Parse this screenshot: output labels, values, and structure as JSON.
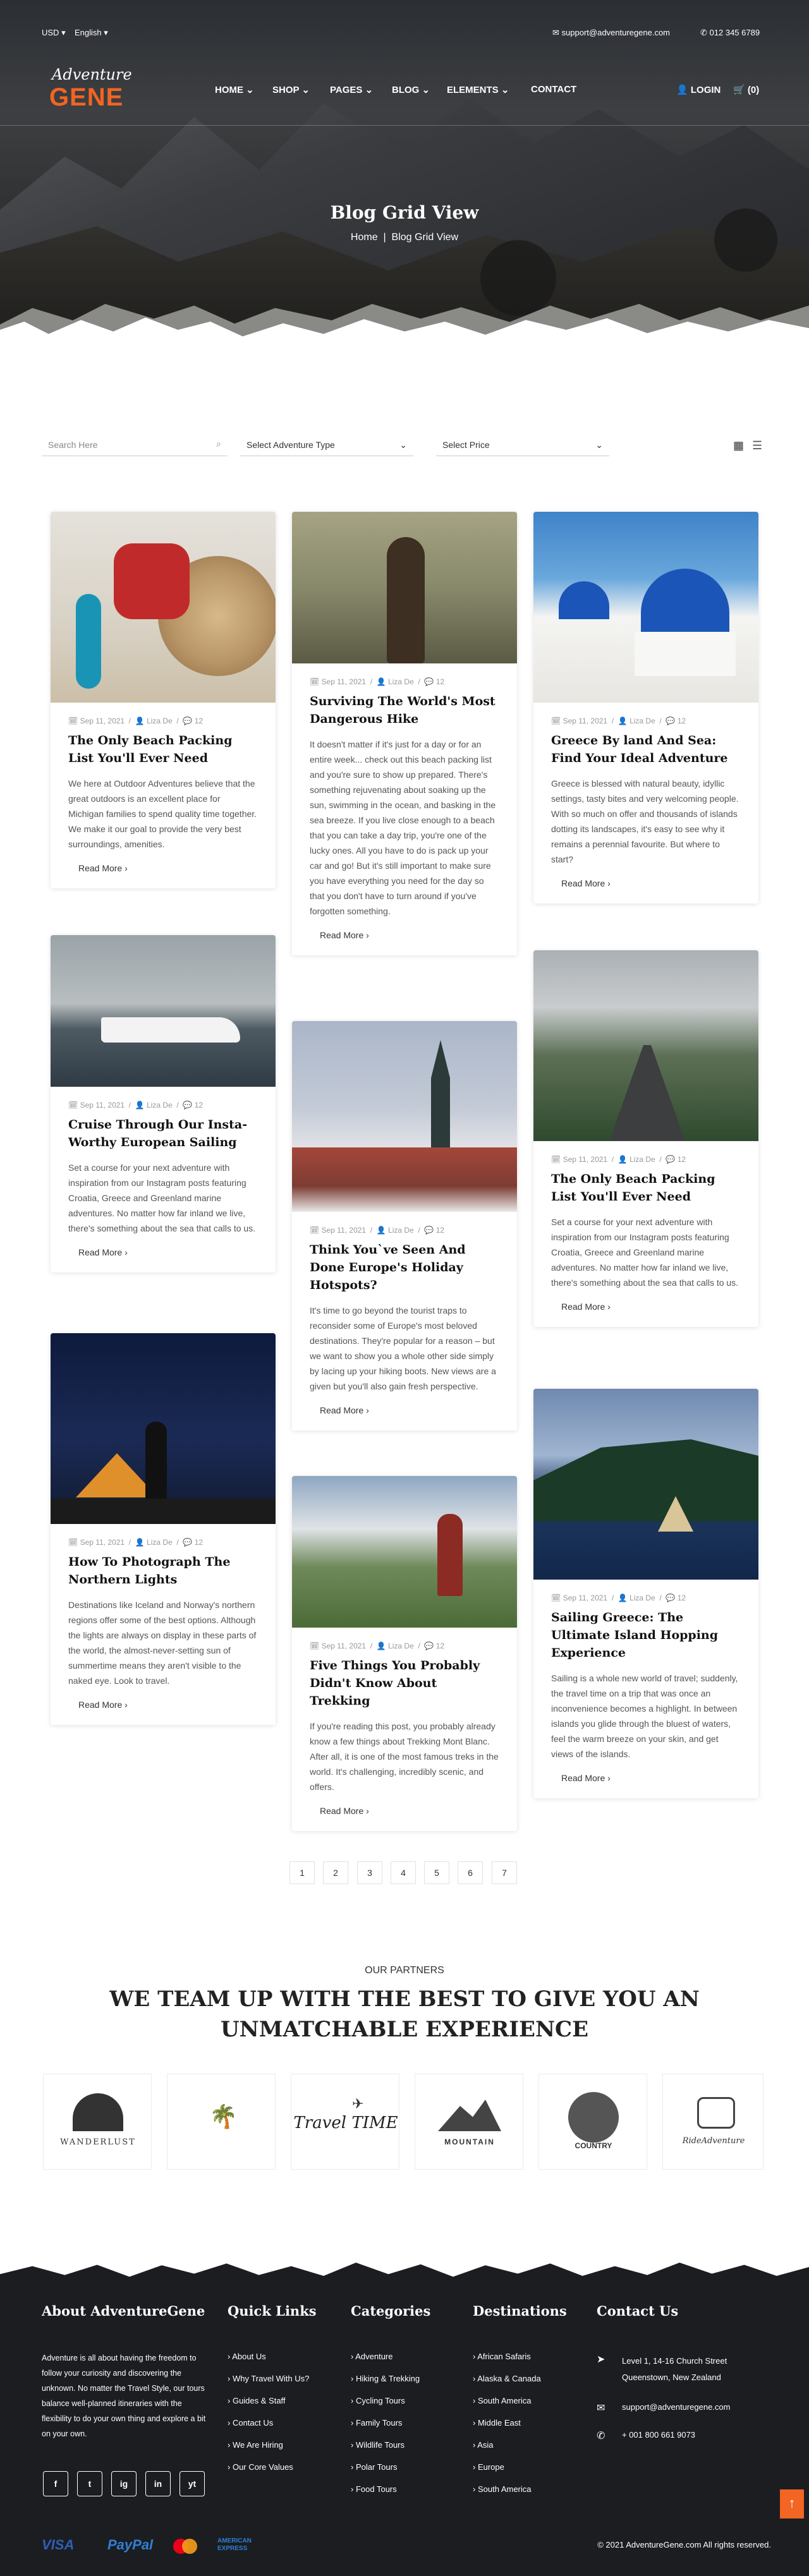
{
  "topbar": {
    "currency": "USD",
    "language": "English",
    "email": "support@adventuregene.com",
    "phone": "012 345 6789"
  },
  "logo": {
    "line1": "Adventure",
    "line2": "GENE"
  },
  "nav": {
    "items": [
      "HOME",
      "SHOP",
      "PAGES",
      "BLOG",
      "ELEMENTS",
      "CONTACT"
    ],
    "login": "LOGIN",
    "cart": "(0)"
  },
  "hero": {
    "title": "Blog Grid View",
    "crumb_home": "Home",
    "crumb_sep": "|",
    "crumb_current": "Blog Grid View"
  },
  "filters": {
    "search_placeholder": "Search Here",
    "type": "Select Adventure Type",
    "price": "Select Price"
  },
  "posts": [
    {
      "date": "Sep 11, 2021",
      "author": "Liza De",
      "comments": "12",
      "title": "The Only Beach Packing List You'll Ever Need",
      "excerpt": "We here at Outdoor Adventures believe that the great outdoors is an excellent place for Michigan families to spend quality time together. We make it our goal to provide the very best surroundings, amenities.",
      "more": "Read More"
    },
    {
      "date": "Sep 11, 2021",
      "author": "Liza De",
      "comments": "12",
      "title": "Surviving The World's Most Dangerous Hike",
      "excerpt": "It doesn't matter if it's just for a day or for an entire week... check out this beach packing list and you're sure to show up prepared. There's something rejuvenating about soaking up the sun, swimming in the ocean, and basking in the sea breeze. If you live close enough to a beach that you can take a day trip, you're one of the lucky ones. All you have to do is pack up your car and go! But it's still important to make sure you have everything you need for the day so that you don't have to turn around if you've forgotten something.",
      "more": "Read More"
    },
    {
      "date": "Sep 11, 2021",
      "author": "Liza De",
      "comments": "12",
      "title": "Greece By land And Sea: Find Your Ideal Adventure",
      "excerpt": "Greece is blessed with natural beauty, idyllic settings, tasty bites and very welcoming people. With so much on offer and thousands of islands dotting its landscapes, it's easy to see why it remains a perennial favourite. But where to start?",
      "more": "Read More"
    },
    {
      "date": "Sep 11, 2021",
      "author": "Liza De",
      "comments": "12",
      "title": "Cruise Through Our Insta-Worthy European Sailing",
      "excerpt": "Set a course for your next adventure with inspiration from our Instagram posts featuring Croatia, Greece and Greenland marine adventures. No matter how far inland we live, there's something about the sea that calls to us.",
      "more": "Read More"
    },
    {
      "date": "Sep 11, 2021",
      "author": "Liza De",
      "comments": "12",
      "title": "Think You`ve Seen And Done Europe's Holiday Hotspots?",
      "excerpt": "It's time to go beyond the tourist traps to reconsider some of Europe's most beloved destinations. They're popular for a reason – but we want to show you a whole other side simply by lacing up your hiking boots. New views are a given but you'll also gain fresh perspective.",
      "more": "Read More"
    },
    {
      "date": "Sep 11, 2021",
      "author": "Liza De",
      "comments": "12",
      "title": "The Only Beach Packing List You'll Ever Need",
      "excerpt": "Set a course for your next adventure with inspiration from our Instagram posts featuring Croatia, Greece and Greenland marine adventures. No matter how far inland we live, there's something about the sea that calls to us.",
      "more": "Read More"
    },
    {
      "date": "Sep 11, 2021",
      "author": "Liza De",
      "comments": "12",
      "title": "How To Photograph The Northern Lights",
      "excerpt": "Destinations like Iceland and Norway's northern regions offer some of the best options. Although the lights are always on display in these parts of the world, the almost-never-setting sun of summertime means they aren't visible to the naked eye. Look to travel.",
      "more": "Read More"
    },
    {
      "date": "Sep 11, 2021",
      "author": "Liza De",
      "comments": "12",
      "title": "Five Things You Probably Didn't Know About Trekking",
      "excerpt": "If you're reading this post, you probably already know a few things about Trekking Mont Blanc. After all, it is one of the most famous treks in the world. It's challenging, incredibly scenic, and offers.",
      "more": "Read More"
    },
    {
      "date": "Sep 11, 2021",
      "author": "Liza De",
      "comments": "12",
      "title": "Sailing Greece: The Ultimate Island Hopping Experience",
      "excerpt": "Sailing is a whole new world of travel; suddenly, the travel time on a trip that was once an inconvenience becomes a highlight. In between islands you glide through the bluest of waters, feel the warm breeze on your skin, and get views of the islands.",
      "more": "Read More"
    }
  ],
  "pagination": [
    "1",
    "2",
    "3",
    "4",
    "5",
    "6",
    "7"
  ],
  "partners": {
    "subtitle": "OUR PARTNERS",
    "title_line1": "WE TEAM UP WITH THE BEST TO GIVE YOU AN",
    "title_line2": "UNMATCHABLE EXPERIENCE",
    "logos": [
      "WANDERLUST",
      "",
      "Travel TIME",
      "MOUNTAIN",
      "COUNTRY",
      "RideAdventure"
    ]
  },
  "footer": {
    "about_title": "About AdventureGene",
    "about_text": "Adventure is all about having the freedom to follow your curiosity and discovering the unknown. No matter the Travel Style, our tours balance well-planned itineraries with the flexibility to do your own thing and explore a bit on your own.",
    "quick_title": "Quick Links",
    "quick": [
      "About Us",
      "Why Travel With Us?",
      "Guides & Staff",
      "Contact Us",
      "We Are Hiring",
      "Our Core Values"
    ],
    "cat_title": "Categories",
    "cats": [
      "Adventure",
      "Hiking & Trekking",
      "Cycling Tours",
      "Family Tours",
      "Wildlife Tours",
      "Polar Tours",
      "Food Tours"
    ],
    "dest_title": "Destinations",
    "dests": [
      "African Safaris",
      "Alaska & Canada",
      "South America",
      "Middle East",
      "Asia",
      "Europe",
      "South America"
    ],
    "contact_title": "Contact Us",
    "address1": "Level 1, 14-16 Church Street",
    "address2": "Queenstown, New Zealand",
    "email": "support@adventuregene.com",
    "phone": "+ 001 800 661 9073",
    "social": [
      "f",
      "t",
      "ig",
      "in",
      "yt"
    ],
    "payments": [
      "VISA",
      "PayPal",
      "",
      "AMERICAN EXPRESS"
    ],
    "copyright": "© 2021 AdventureGene.com All rights reserved."
  }
}
